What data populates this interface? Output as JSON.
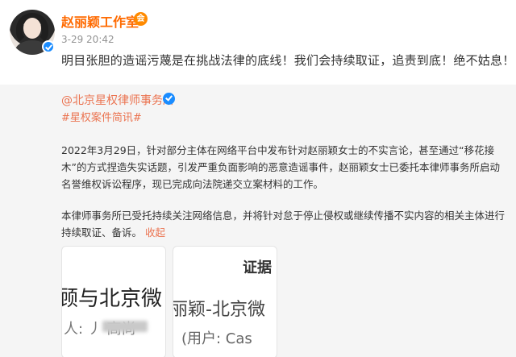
{
  "post": {
    "author": "赵丽颖工作室",
    "vip_badge": "会",
    "time": "3-29 20:42",
    "text": "明目张胆的造谣污蔑是在挑战法律的底线！我们会持续取证，追责到底！绝不姑息！"
  },
  "repost": {
    "author": "@北京星权律师事务所",
    "tag": "#星权案件简讯#",
    "paragraph1": "2022年3月29日，针对部分主体在网络平台中发布针对赵丽颖女士的不实言论，甚至通过“移花接木”的方式捏造失实话题，引发严重负面影响的恶意造谣事件，赵丽颖女士已委托本律师事务所启动名誉维权诉讼程序，现已完成向法院递交立案材料的工作。",
    "paragraph2": "本律师事务所已受托持续关注网络信息，并将针对怠于停止侵权或继续传播不实内容的相关主体进行持续取证、备诉。",
    "collapse_label": "收起",
    "images": [
      {
        "line1": "顾与北京微",
        "line2": "人: 丿 高尚"
      },
      {
        "line0": "证据",
        "line1": "丽颖-北京微",
        "line2": "(用户: Cas"
      }
    ]
  },
  "icons": {
    "verified": "verified-badge-icon",
    "vip": "vip-crown-icon"
  },
  "colors": {
    "author": "#ff6a00",
    "link": "#eb7350",
    "verified": "#1a8cff"
  }
}
